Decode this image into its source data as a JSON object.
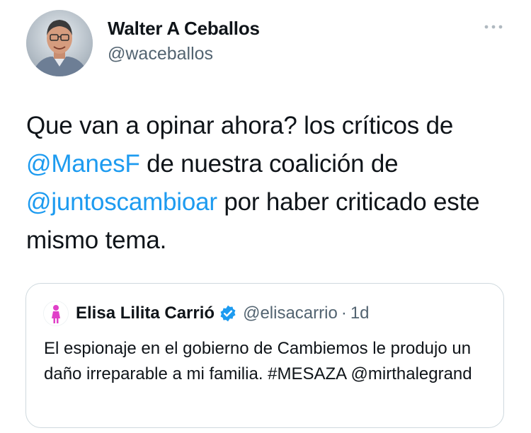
{
  "tweet": {
    "author": {
      "name": "Walter A Ceballos",
      "handle": "@waceballos"
    },
    "more_icon": "more-horizontal-icon",
    "text": {
      "part1": "Que van a opinar ahora? los críticos de ",
      "mention1": "@ManesF",
      "part2": " de nuestra coalición de ",
      "mention2": "@juntoscambioar",
      "part3": " por haber criticado este mismo tema."
    }
  },
  "quote": {
    "name": "Elisa Lilita Carrió",
    "verified_icon": "verified-badge-icon",
    "handle": "@elisacarrio",
    "separator": "·",
    "time": "1d",
    "text": "El espionaje en el gobierno de Cambiemos le produjo un daño irreparable a mi familia. #MESAZA @mirthalegrand"
  },
  "colors": {
    "link": "#1d9bf0",
    "secondary_text": "#536471",
    "border": "#cfd9de",
    "quote_avatar_figure": "#e040c8"
  }
}
